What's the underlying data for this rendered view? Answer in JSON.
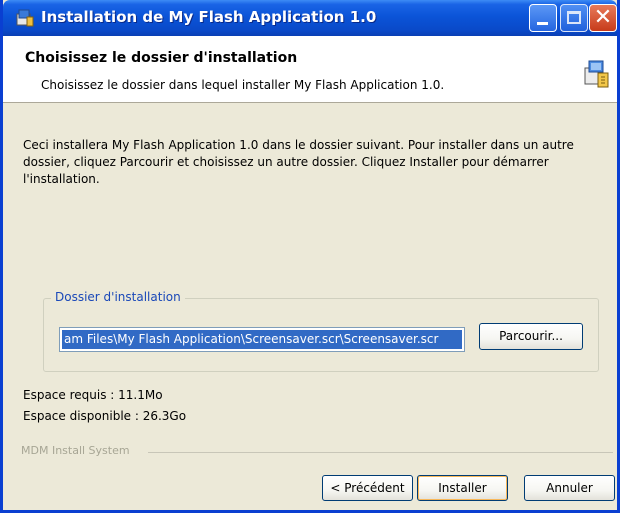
{
  "window": {
    "title": "Installation de My Flash Application 1.0",
    "controls": {
      "minimize": "minimize-icon",
      "maximize": "maximize-icon",
      "close": "close-icon"
    }
  },
  "header": {
    "title": "Choisissez le dossier d'installation",
    "subtitle": "Choisissez le dossier dans lequel installer My Flash Application 1.0."
  },
  "description": "Ceci installera My Flash Application 1.0 dans le dossier suivant. Pour installer dans un autre dossier, cliquez Parcourir et choisissez un autre dossier. Cliquez Installer pour démarrer l'installation.",
  "destination": {
    "group_label": "Dossier d'installation",
    "path_value": "am Files\\My Flash Application\\Screensaver.scr\\Screensaver.scr",
    "browse_label": "Parcourir..."
  },
  "space": {
    "required": "Espace requis : 11.1Mo",
    "available": "Espace disponible : 26.3Go"
  },
  "branding": "MDM Install System",
  "buttons": {
    "previous": "< Précédent",
    "install": "Installer",
    "cancel": "Annuler"
  },
  "colors": {
    "titlebar": "#0a49c8",
    "accent_label": "#1a48b8",
    "selection": "#316ac5",
    "dialog_bg": "#ece9d8"
  }
}
